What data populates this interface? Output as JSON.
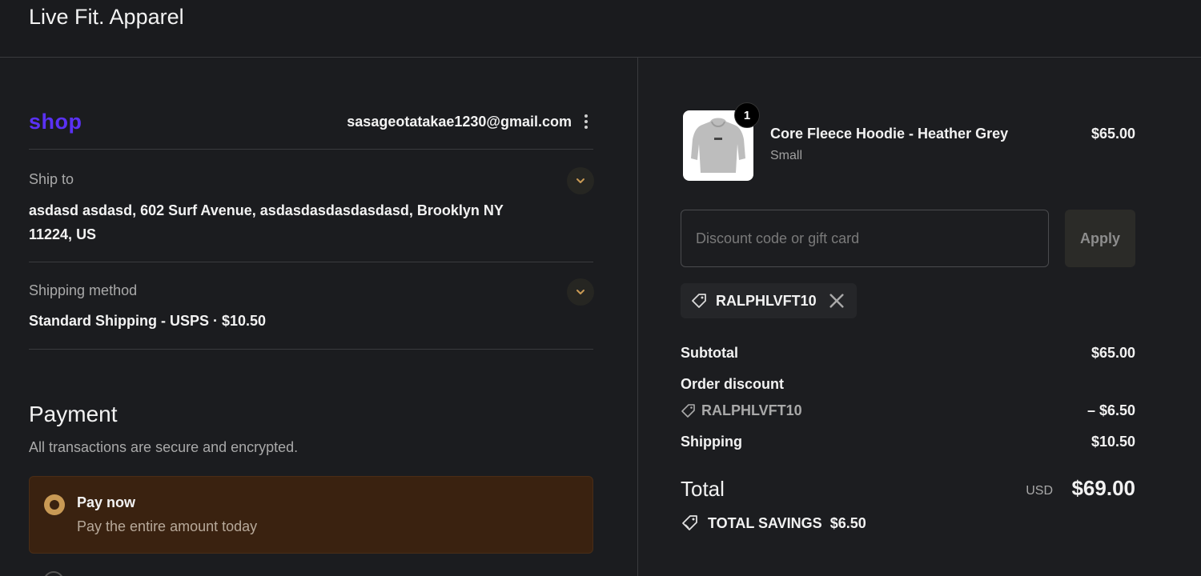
{
  "header": {
    "brand": "Live Fit. Apparel"
  },
  "contact": {
    "shop_logo": "shop",
    "email": "sasageotatakae1230@gmail.com"
  },
  "ship_to": {
    "label": "Ship to",
    "address_line1": "asdasd asdasd, 602 Surf Avenue, asdasdasdasdasdasd, Brooklyn NY",
    "address_line2": "11224, US"
  },
  "shipping_method": {
    "label": "Shipping method",
    "value": "Standard Shipping - USPS · $10.50"
  },
  "payment": {
    "title": "Payment",
    "subtitle": "All transactions are secure and encrypted.",
    "option_title": "Pay now",
    "option_subtitle": "Pay the entire amount today"
  },
  "cart": {
    "item_name": "Core Fleece Hoodie - Heather Grey",
    "item_variant": "Small",
    "item_price": "$65.00",
    "quantity": "1"
  },
  "discount": {
    "placeholder": "Discount code or gift card",
    "apply_label": "Apply",
    "applied_code": "RALPHLVFT10"
  },
  "summary": {
    "subtotal_label": "Subtotal",
    "subtotal_value": "$65.00",
    "order_discount_label": "Order discount",
    "discount_code": "RALPHLVFT10",
    "discount_value": "– $6.50",
    "shipping_label": "Shipping",
    "shipping_value": "$10.50",
    "total_label": "Total",
    "total_currency": "USD",
    "total_value": "$69.00",
    "savings_label": "TOTAL SAVINGS",
    "savings_value": "$6.50"
  },
  "colors": {
    "background": "#1b1c1f",
    "shop_brand": "#5a31f4",
    "payment_selected_bg": "#3a2210",
    "radio_accent": "#c99a55"
  },
  "icons": [
    "chevron-down-icon",
    "kebab-menu-icon",
    "tag-icon",
    "close-icon",
    "radio-selected-icon"
  ]
}
